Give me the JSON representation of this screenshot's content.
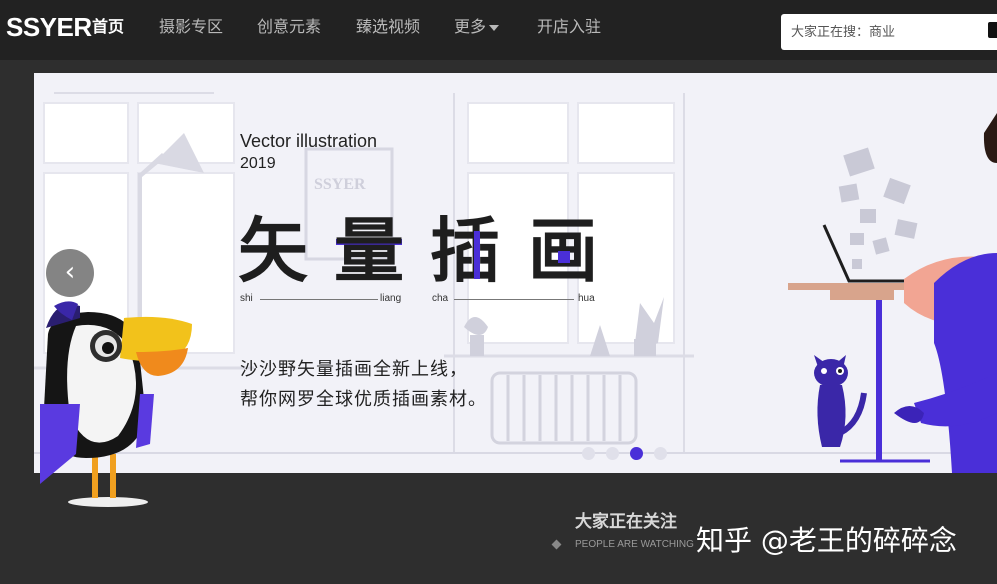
{
  "header": {
    "logo": "SSYER",
    "nav": [
      {
        "label": "首页",
        "active": true
      },
      {
        "label": "摄影专区"
      },
      {
        "label": "创意元素"
      },
      {
        "label": "臻选视频"
      },
      {
        "label": "更多"
      },
      {
        "label": "开店入驻"
      }
    ],
    "search_placeholder": "大家正在搜：商业"
  },
  "banner": {
    "title_en": "Vector illustration",
    "year": "2019",
    "watermark_logo": "SSYER",
    "big_chars": [
      "矢",
      "量",
      "插",
      "画"
    ],
    "pinyin": [
      "shi",
      "liang",
      "cha",
      "hua"
    ],
    "desc_line1": "沙沙野矢量插画全新上线，",
    "desc_line2": "帮你网罗全球优质插画素材。",
    "prev_icon": "‹",
    "slide_count": 4,
    "active_slide": 2
  },
  "section": {
    "title": "大家正在关注",
    "subtitle": "PEOPLE ARE WATCHING"
  },
  "watermark": "知乎 @老王的碎碎念",
  "colors": {
    "accent": "#4a2fd8",
    "nav_bg": "#222222",
    "page_bg": "#2e2e2e"
  }
}
